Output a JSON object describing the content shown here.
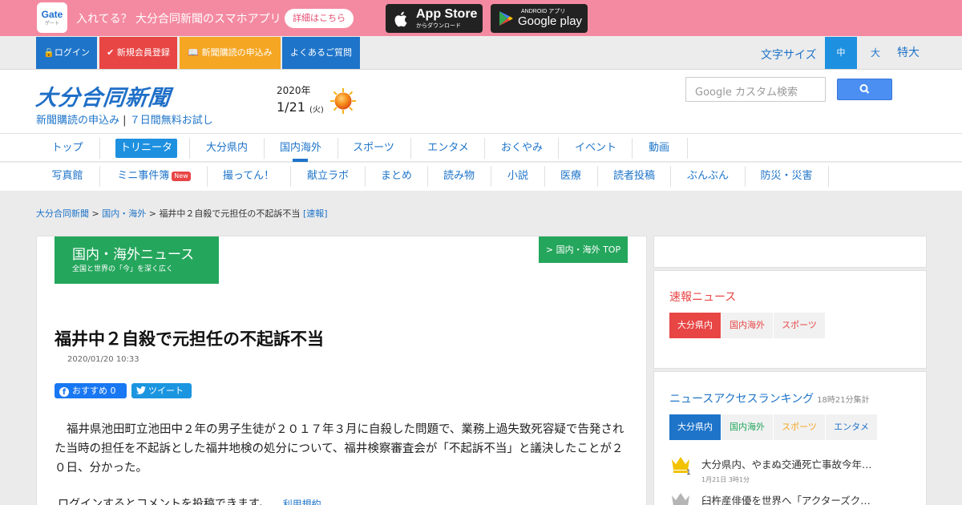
{
  "banner": {
    "gate_logo": "Gate",
    "gate_sub": "ゲート",
    "text": "入れてる？ 大分合同新聞のスマホアプリ",
    "details_button": "詳細はこちら",
    "appstore_big": "App Store",
    "appstore_small": "からダウンロード",
    "googleplay_small": "ANDROID アプリ",
    "googleplay_big": "Google play"
  },
  "topbar": {
    "login": "ログイン",
    "register": "新規会員登録",
    "subscribe": "新聞購読の申込み",
    "faq": "よくあるご質問",
    "font_size_label": "文字サイズ",
    "font_mid": "中",
    "font_large": "大",
    "font_xl": "特大"
  },
  "header": {
    "logo": "大分合同新聞",
    "link_subscribe": "新聞購読の申込み",
    "link_trial": "７日間無料お試し",
    "separator": "|",
    "year": "2020年",
    "date": "1/21",
    "dow": "(火)",
    "weather_icon": "sunny-icon",
    "search_placeholder": "Google カスタム検索"
  },
  "nav_primary": [
    "トップ",
    "トリニータ",
    "大分県内",
    "国内海外",
    "スポーツ",
    "エンタメ",
    "おくやみ",
    "イベント",
    "動画"
  ],
  "nav_secondary": [
    "写真館",
    "ミニ事件簿",
    "撮ってん！",
    "献立ラボ",
    "まとめ",
    "読み物",
    "小説",
    "医療",
    "読者投稿",
    "ぶんぶん",
    "防災・災害"
  ],
  "nav_new_badge": "New",
  "breadcrumb": {
    "home": "大分合同新聞",
    "sep": " > ",
    "category": "国内・海外",
    "current": "福井中２自殺で元担任の不起訴不当",
    "tag": "[速報]"
  },
  "article": {
    "section_title": "国内・海外ニュース",
    "section_sub": "全国と世界の「今」を深く広く",
    "section_top_link": "> 国内・海外 TOP",
    "title": "福井中２自殺で元担任の不起訴不当",
    "date": "2020/01/20 10:33",
    "fb_label": "おすすめ 0",
    "tweet_label": "ツイート",
    "body": "福井県池田町立池田中２年の男子生徒が２０１７年３月に自殺した問題で、業務上過失致死容疑で告発された当時の担任を不起訴とした福井地検の処分について、福井検察審査会が「不起訴不当」と議決したことが２０日、分かった。",
    "login_note": "ログインするとコメントを投稿できます。",
    "terms_link": "利用規約"
  },
  "sidebar": {
    "news_title": "速報ニュース",
    "news_tabs": [
      "大分県内",
      "国内海外",
      "スポーツ"
    ],
    "ranking_title": "ニュースアクセスランキング",
    "ranking_note": "18時21分集計",
    "ranking_tabs": [
      "大分県内",
      "国内海外",
      "スポーツ",
      "エンタメ"
    ],
    "ranking_items": [
      {
        "title": "大分県内、やまぬ交通死亡事故今年…",
        "meta": "1月21日 3時1分",
        "rank": "1"
      },
      {
        "title": "臼杵産俳優を世界へ「アクターズク…",
        "meta": "",
        "rank": "2"
      }
    ],
    "colors": {
      "red": "#e84545",
      "blue": "#1e74c9",
      "green": "#24a65c",
      "orange": "#f5a623",
      "pink": "#f48aa1"
    }
  }
}
